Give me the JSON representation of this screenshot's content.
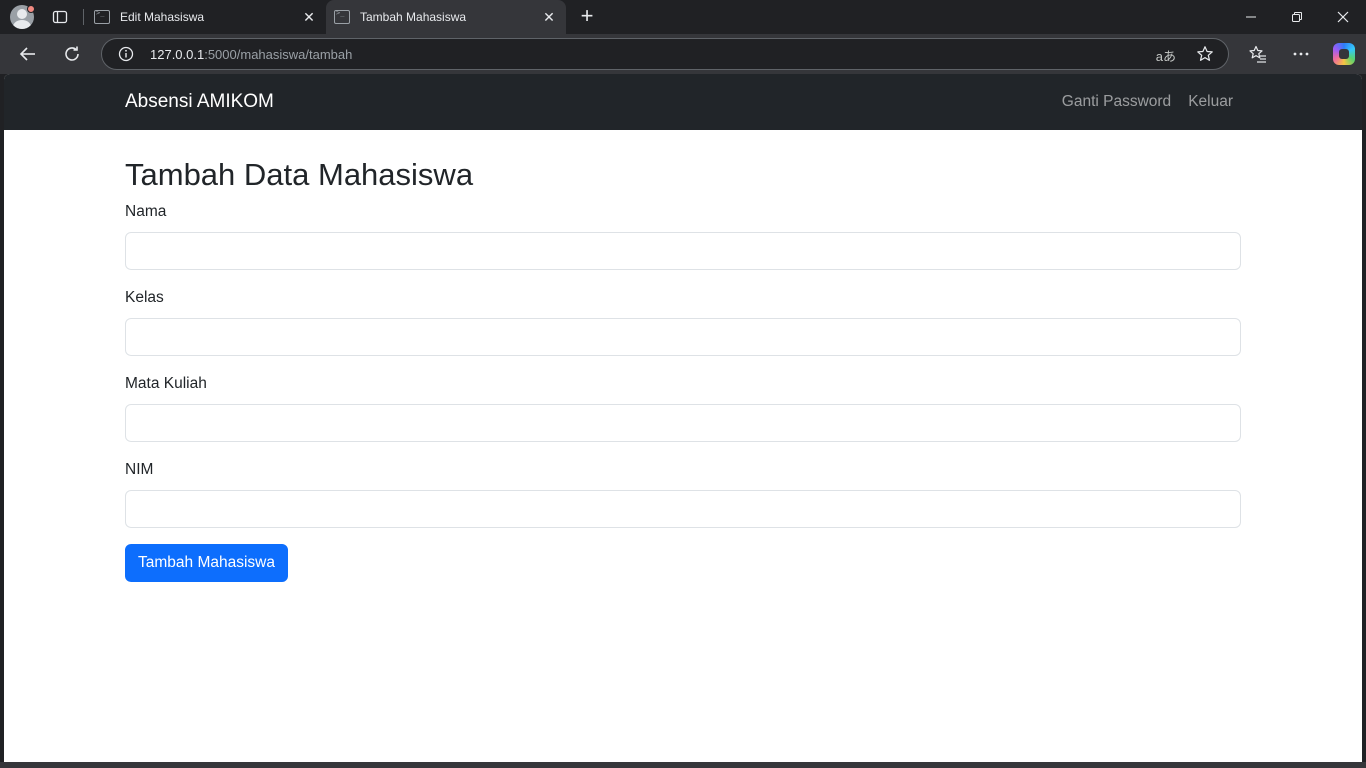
{
  "browser": {
    "tabs": [
      {
        "title": "Edit Mahasiswa",
        "active": false
      },
      {
        "title": "Tambah Mahasiswa",
        "active": true
      }
    ],
    "url_host": "127.0.0.1",
    "url_path": ":5000/mahasiswa/tambah",
    "icons": {
      "profile": "profile-avatar-icon",
      "tab_actions": "tab-actions-icon",
      "back": "back-arrow-icon",
      "reload": "reload-icon",
      "info": "info-icon",
      "read_aloud": "read-aloud-icon",
      "favorite": "star-icon",
      "favorites": "favorites-icon",
      "more": "more-icon",
      "copilot": "copilot-icon"
    },
    "read_aloud_glyph": "aあ"
  },
  "navbar": {
    "brand": "Absensi AMIKOM",
    "links": [
      "Ganti Password",
      "Keluar"
    ],
    "background": "#212529"
  },
  "page": {
    "title": "Tambah Data Mahasiswa",
    "fields": [
      {
        "label": "Nama",
        "value": ""
      },
      {
        "label": "Kelas",
        "value": ""
      },
      {
        "label": "Mata Kuliah",
        "value": ""
      },
      {
        "label": "NIM",
        "value": ""
      }
    ],
    "submit_label": "Tambah Mahasiswa",
    "accent": "#0d6efd"
  }
}
